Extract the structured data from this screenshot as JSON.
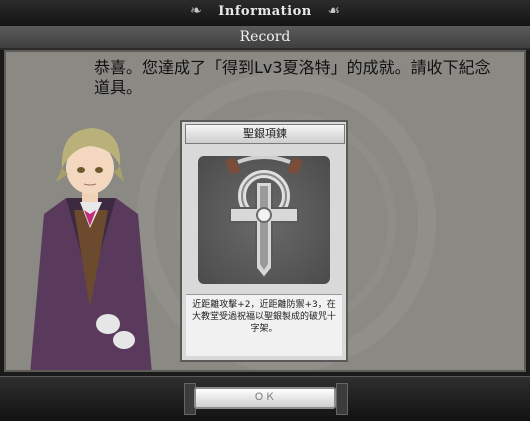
{
  "header": {
    "title": "Information",
    "ornament_left": "❧",
    "ornament_right": "☙"
  },
  "subheader": {
    "title": "Record"
  },
  "message": {
    "text": "恭喜。您達成了「得到Lv3夏洛特」的成就。請收下紀念道具。"
  },
  "card": {
    "title": "聖銀項鍊",
    "description": "近距離攻擊+2，近距離防禦+3，在大教堂受過祝福以聖銀製成的破咒十字架。"
  },
  "footer": {
    "ok_label": "ＯＫ"
  },
  "colors": {
    "panel": "#8b8984",
    "header": "#141414",
    "record_bar": "#4d4d4d"
  }
}
